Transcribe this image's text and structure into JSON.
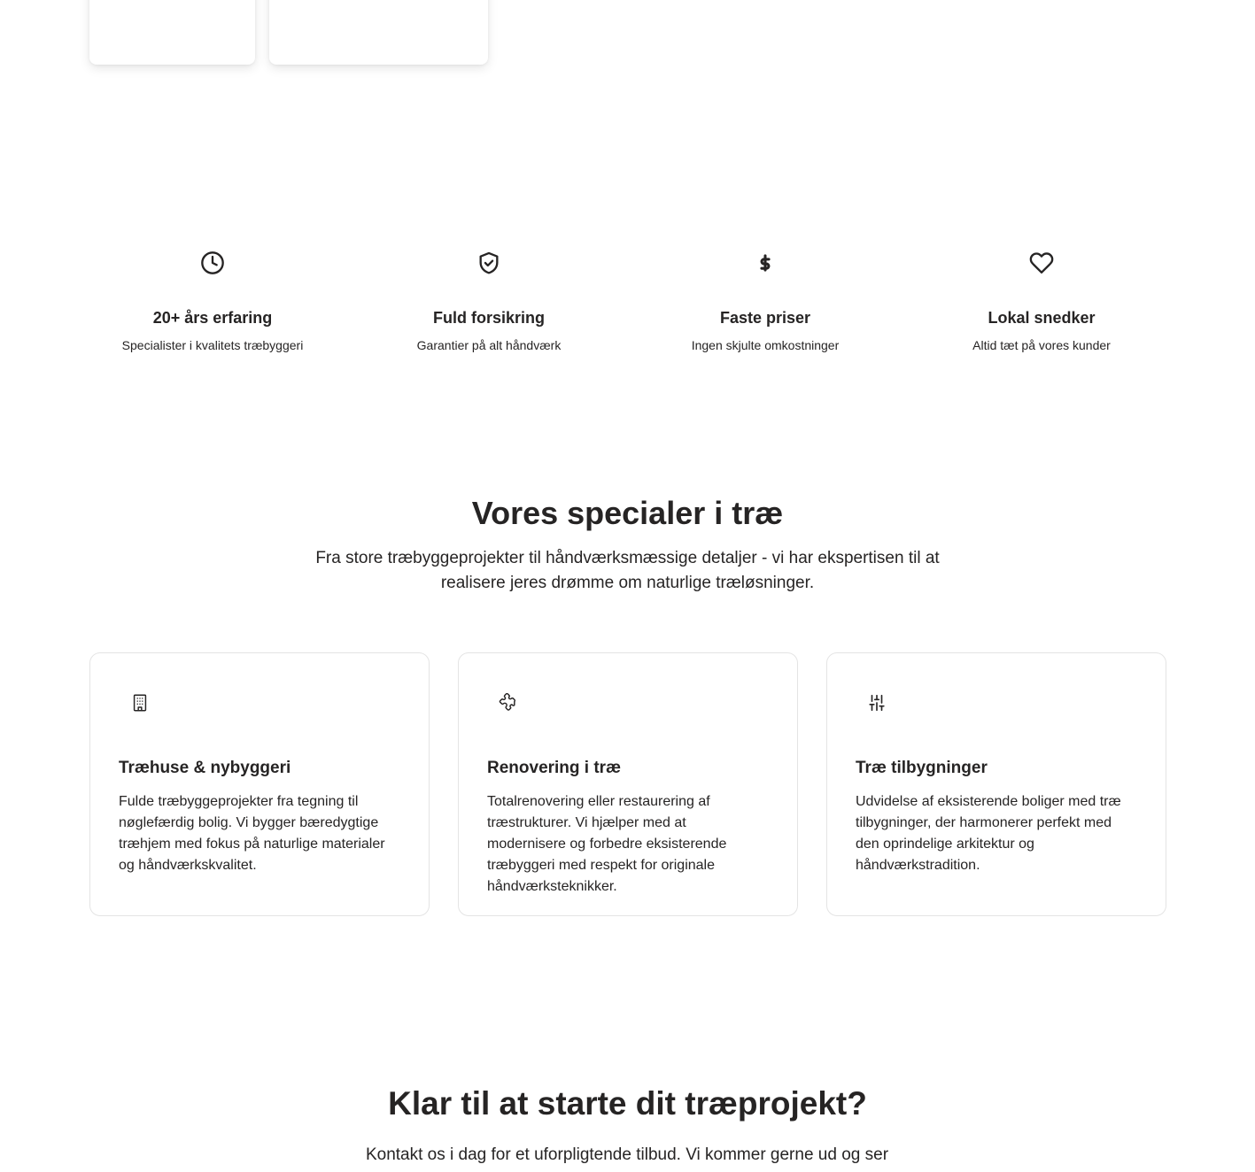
{
  "features": [
    {
      "icon": "clock-icon",
      "title": "20+ års erfaring",
      "text": "Specialister i kvalitets træbyggeri"
    },
    {
      "icon": "shield-check-icon",
      "title": "Fuld forsikring",
      "text": "Garantier på alt håndværk"
    },
    {
      "icon": "dollar-icon",
      "title": "Faste priser",
      "text": "Ingen skjulte omkostninger"
    },
    {
      "icon": "heart-icon",
      "title": "Lokal snedker",
      "text": "Altid tæt på vores kunder"
    }
  ],
  "specials": {
    "title": "Vores specialer i træ",
    "intro": "Fra store træbyggeprojekter til håndværksmæssige detaljer - vi har ekspertisen til at realisere jeres drømme om naturlige træløsninger.",
    "cards": [
      {
        "icon": "building-icon",
        "title": "Træhuse & nybyggeri",
        "text": "Fulde træbyggeprojekter fra tegning til nøglefærdig bolig. Vi bygger bæredygtige træhjem med fokus på naturlige materialer og håndværkskvalitet."
      },
      {
        "icon": "puzzle-icon",
        "title": "Renovering i træ",
        "text": "Totalrenovering eller restaurering af træstrukturer. Vi hjælper med at modernisere og forbedre eksisterende træbyggeri med respekt for originale håndværksteknikker."
      },
      {
        "icon": "sliders-icon",
        "title": "Træ tilbygninger",
        "text": "Udvidelse af eksisterende boliger med træ tilbygninger, der harmonerer perfekt med den oprindelige arkitektur og håndværkstradition."
      }
    ]
  },
  "cta": {
    "title": "Klar til at starte dit træprojekt?",
    "text": "Kontakt os i dag for et uforpligtende tilbud. Vi kommer gerne ud og ser"
  }
}
